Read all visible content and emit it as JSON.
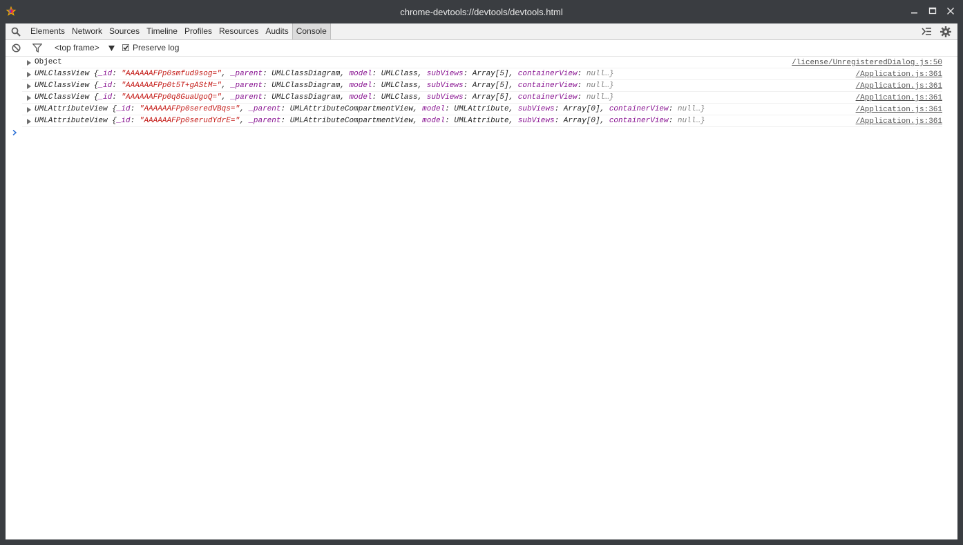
{
  "window": {
    "title": "chrome-devtools://devtools/devtools.html",
    "colors": {
      "titlebar": "#3a3d41",
      "accent_star": "#f0b000"
    },
    "icons": {
      "app": "star-app-icon",
      "minimize": "minimize-icon",
      "maximize": "maximize-icon",
      "close": "close-icon"
    }
  },
  "tabbar": {
    "tabs": [
      {
        "label": "Elements"
      },
      {
        "label": "Network"
      },
      {
        "label": "Sources"
      },
      {
        "label": "Timeline"
      },
      {
        "label": "Profiles"
      },
      {
        "label": "Resources"
      },
      {
        "label": "Audits"
      },
      {
        "label": "Console",
        "active": true
      }
    ],
    "icons": {
      "search": "search-icon",
      "drawer": "console-drawer-icon",
      "settings": "gear-icon"
    }
  },
  "toolbar": {
    "frame_select": "<top frame>",
    "preserve_log_label": "Preserve log",
    "preserve_log_checked": true,
    "icons": {
      "clear": "clear-console-icon",
      "filter": "filter-icon",
      "dropdown": "dropdown-arrow-icon"
    }
  },
  "console": {
    "messages": [
      {
        "class_name": "Object",
        "source": "/license/UnregisteredDialog.js:50"
      },
      {
        "class_name": "UMLClassView",
        "id": "\"AAAAAAFPp0smfud9sog=\"",
        "parent": "UMLClassDiagram",
        "model": "UMLClass",
        "subviews": "Array[5]",
        "container": "null…}",
        "source": "/Application.js:361"
      },
      {
        "class_name": "UMLClassView",
        "id": "\"AAAAAAFPp0t5T+gAStM=\"",
        "parent": "UMLClassDiagram",
        "model": "UMLClass",
        "subviews": "Array[5]",
        "container": "null…}",
        "source": "/Application.js:361"
      },
      {
        "class_name": "UMLClassView",
        "id": "\"AAAAAAFPp0q8GuaUgoQ=\"",
        "parent": "UMLClassDiagram",
        "model": "UMLClass",
        "subviews": "Array[5]",
        "container": "null…}",
        "source": "/Application.js:361"
      },
      {
        "class_name": "UMLAttributeView",
        "id": "\"AAAAAAFPp0seredVBqs=\"",
        "parent": "UMLAttributeCompartmentView",
        "model": "UMLAttribute",
        "subviews": "Array[0]",
        "container": "null…}",
        "source": "/Application.js:361"
      },
      {
        "class_name": "UMLAttributeView",
        "id": "\"AAAAAAFPp0serudYdrE=\"",
        "parent": "UMLAttributeCompartmentView",
        "model": "UMLAttribute",
        "subviews": "Array[0]",
        "container": "null…}",
        "source": "/Application.js:361"
      }
    ],
    "keys": {
      "id": "_id",
      "parent": "_parent",
      "model": "model",
      "subviews": "subViews",
      "container": "containerView"
    },
    "prompt_icon": "prompt-caret-icon"
  }
}
